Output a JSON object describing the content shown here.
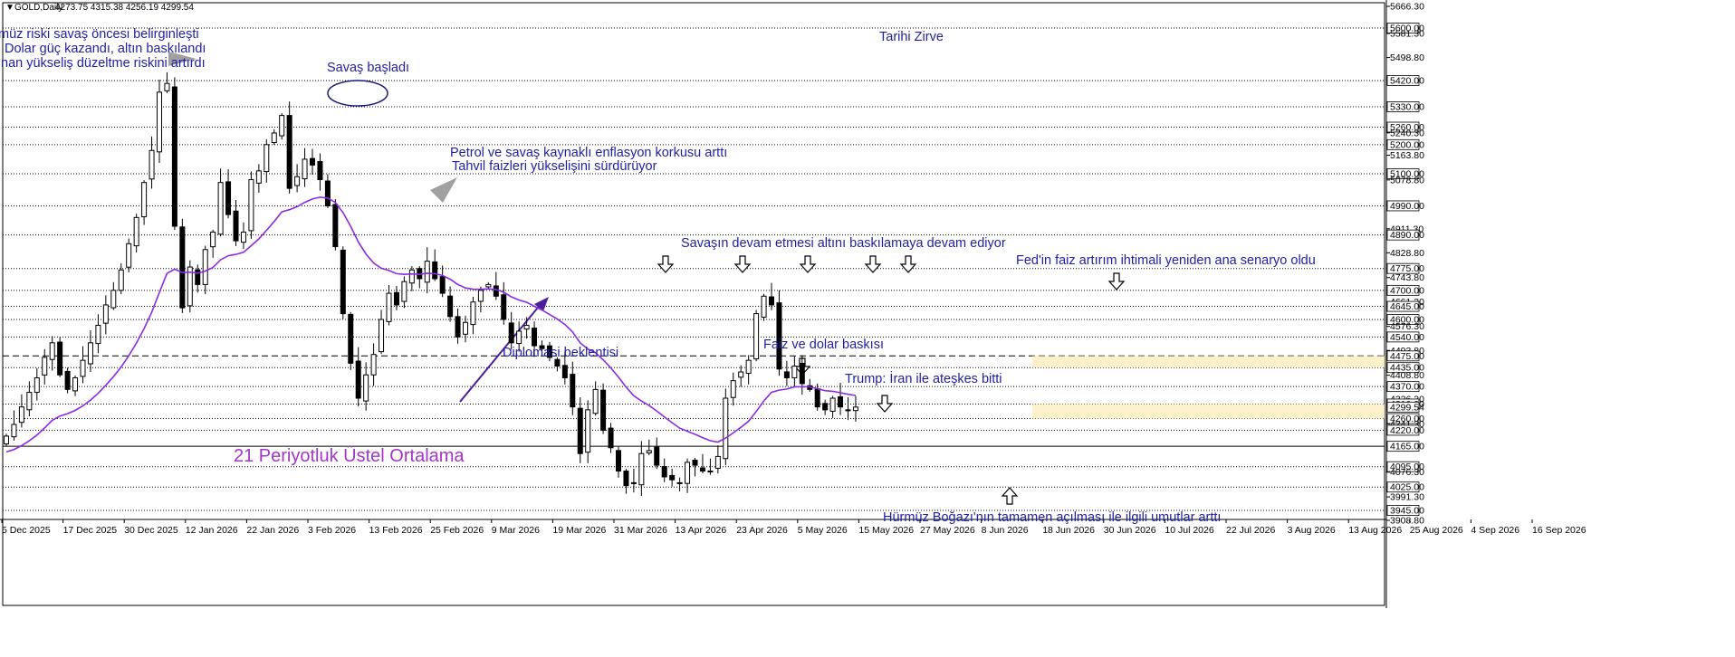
{
  "window": {
    "symbol": "GOLD,Daily",
    "ohlc": "4273.75 4315.38 4256.19 4299.54"
  },
  "annotations": {
    "pre_war": [
      "müz riski savaş öncesi belirginleşti",
      "Dolar güç kazandı, altın baskılandı",
      "nan yükseliş düzeltme riskini artırdı"
    ],
    "war_started": "Savaş başladı",
    "all_time_high": "Tarihi Zirve",
    "inflation_1": "Petrol ve savaş kaynaklı enflasyon korkusu arttı",
    "inflation_2": "Tahvil faizleri yükselişini sürdürüyor",
    "war_pressure": "Savaşın devam etmesi altını baskılamaya devam ediyor",
    "fed": "Fed'in faiz artırım ihtimali yeniden ana senaryo oldu",
    "rate_dollar": "Faiz ve dolar baskısı",
    "diplomacy": "Diplomasi beklentisi",
    "ceasefire": "Trump: İran ile ateşkes bitti",
    "hormuz": "Hürmüz Boğazı'nın tamamen açılması ile ilgili umutlar arttı",
    "ema_label": "21 Periyotluk Üstel Ortalama"
  },
  "chart_data": {
    "type": "candlestick",
    "title": "GOLD,Daily",
    "ylim": [
      3908.8,
      5666.3
    ],
    "y_ticks": [
      "5666.30",
      "5600.00",
      "5581.30",
      "5498.80",
      "5420.00",
      "5330.00",
      "5260.00",
      "5240.30",
      "5200.00",
      "5163.80",
      "5100.00",
      "5078.80",
      "4990.00",
      "4911.30",
      "4890.00",
      "4828.80",
      "4775.00",
      "4743.80",
      "4700.00",
      "4661.30",
      "4645.00",
      "4600.00",
      "4576.30",
      "4540.00",
      "4493.80",
      "4475.00",
      "4435.00",
      "4408.80",
      "4370.00",
      "4326.30",
      "4310.00",
      "4299.54",
      "4260.00",
      "4241.30",
      "4220.00",
      "4165.00",
      "4095.00",
      "4076.30",
      "4025.00",
      "3991.30",
      "3945.00",
      "3908.80"
    ],
    "y_ticks_boxed": [
      "5600.00",
      "5420.00",
      "5330.00",
      "5260.00",
      "5200.00",
      "5100.00",
      "4990.00",
      "4890.00",
      "4775.00",
      "4700.00",
      "4645.00",
      "4600.00",
      "4540.00",
      "4475.00",
      "4435.00",
      "4370.00",
      "4310.00",
      "4299.54",
      "4260.00",
      "4220.00",
      "4165.00",
      "4095.00",
      "4025.00",
      "3945.00"
    ],
    "x_ticks": [
      "5 Dec 2025",
      "17 Dec 2025",
      "30 Dec 2025",
      "12 Jan 2026",
      "22 Jan 2026",
      "3 Feb 2026",
      "13 Feb 2026",
      "25 Feb 2026",
      "9 Mar 2026",
      "19 Mar 2026",
      "31 Mar 2026",
      "13 Apr 2026",
      "23 Apr 2026",
      "5 May 2026",
      "15 May 2026",
      "27 May 2026",
      "8 Jun 2026",
      "18 Jun 2026",
      "30 Jun 2026",
      "10 Jul 2026",
      "22 Jul 2026",
      "3 Aug 2026",
      "13 Aug 2026",
      "25 Aug 2026",
      "4 Sep 2026",
      "16 Sep 2026"
    ],
    "dotted_levels": [
      5600,
      5420,
      5330,
      5260,
      5200,
      5100,
      4990,
      4890,
      4775,
      4700,
      4645,
      4600,
      4540,
      4435,
      4370,
      4310,
      4260,
      4220,
      4095,
      4025,
      3945
    ],
    "dashed_level": 4475,
    "solid_level": 4165,
    "zones": [
      [
        4435,
        4475
      ],
      [
        4260,
        4310
      ]
    ],
    "ema_period": 21,
    "anchors": [
      4200,
      4240,
      4300,
      4350,
      4400,
      4470,
      4520,
      4410,
      4360,
      4400,
      4460,
      4520,
      4580,
      4650,
      4700,
      4770,
      4860,
      4950,
      5070,
      5180,
      5380,
      5410,
      4920,
      4640,
      4780,
      4720,
      4840,
      4900,
      5070,
      4960,
      4870,
      4900,
      5080,
      5110,
      5200,
      5240,
      5300,
      5050,
      5090,
      5150,
      5130,
      5080,
      4990,
      4850,
      4620,
      4450,
      4330,
      4410,
      4480,
      4600,
      4690,
      4650,
      4730,
      4770,
      4740,
      4800,
      4740,
      4690,
      4610,
      4540,
      4590,
      4660,
      4700,
      4720,
      4680,
      4600,
      4520,
      4560,
      4580,
      4510,
      4500,
      4470,
      4440,
      4400,
      4300,
      4140,
      4290,
      4360,
      4220,
      4160,
      4080,
      4030,
      4040,
      4140,
      4150,
      4100,
      4060,
      4050,
      4040,
      4110,
      4100,
      4080,
      4080,
      4130,
      4330,
      4390,
      4420,
      4460,
      4620,
      4680,
      4650,
      4430,
      4400,
      4440,
      4380,
      4360,
      4300,
      4290,
      4330,
      4300,
      4290,
      4299.54
    ]
  }
}
